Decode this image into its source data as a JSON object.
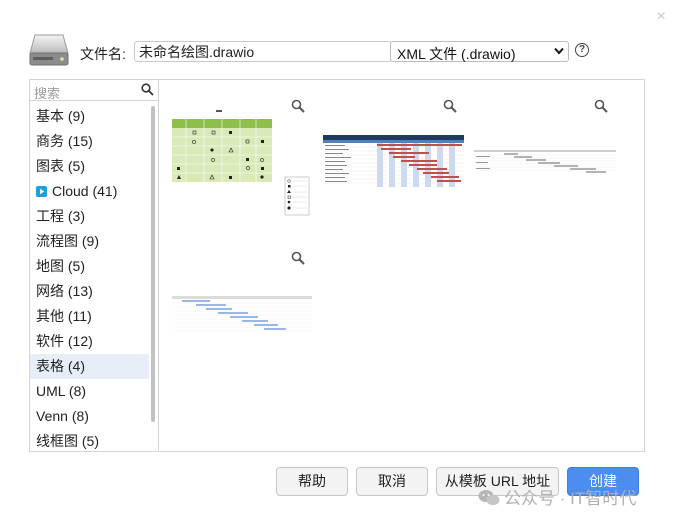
{
  "dialog": {
    "filename_label": "文件名:",
    "filename_value": "未命名绘图.drawio",
    "format_value": "XML 文件 (.drawio)",
    "help_glyph": "?",
    "close_glyph": "×"
  },
  "sidebar": {
    "search_placeholder": "搜索",
    "items": [
      {
        "label": "基本 (9)"
      },
      {
        "label": "商务 (15)"
      },
      {
        "label": "图表 (5)"
      },
      {
        "label": "Cloud (41)"
      },
      {
        "label": "工程 (3)"
      },
      {
        "label": "流程图 (9)"
      },
      {
        "label": "地图 (5)"
      },
      {
        "label": "网络 (13)"
      },
      {
        "label": "其他 (11)"
      },
      {
        "label": "软件 (12)"
      },
      {
        "label": "表格 (4)"
      },
      {
        "label": "UML (8)"
      },
      {
        "label": "Venn (8)"
      },
      {
        "label": "线框图 (5)"
      }
    ],
    "selected": "表格 (4)"
  },
  "templates": {
    "count": 4,
    "items": [
      {
        "name": "table-template-1",
        "icon": "zoom-icon"
      },
      {
        "name": "table-template-2",
        "icon": "zoom-icon"
      },
      {
        "name": "table-template-3",
        "icon": "zoom-icon"
      },
      {
        "name": "table-template-4",
        "icon": "zoom-icon"
      }
    ]
  },
  "buttons": {
    "help": "帮助",
    "cancel": "取消",
    "from_url": "从模板 URL 地址",
    "create": "创建"
  },
  "watermark": {
    "text": "公众号 · IT智时代"
  },
  "colors": {
    "primary_button": "#4b8df0",
    "selected_item": "#e8eef7",
    "cloud_icon": "#1ba1e2",
    "template_green": "#b9d98a",
    "gantt_red": "#c0504d"
  }
}
